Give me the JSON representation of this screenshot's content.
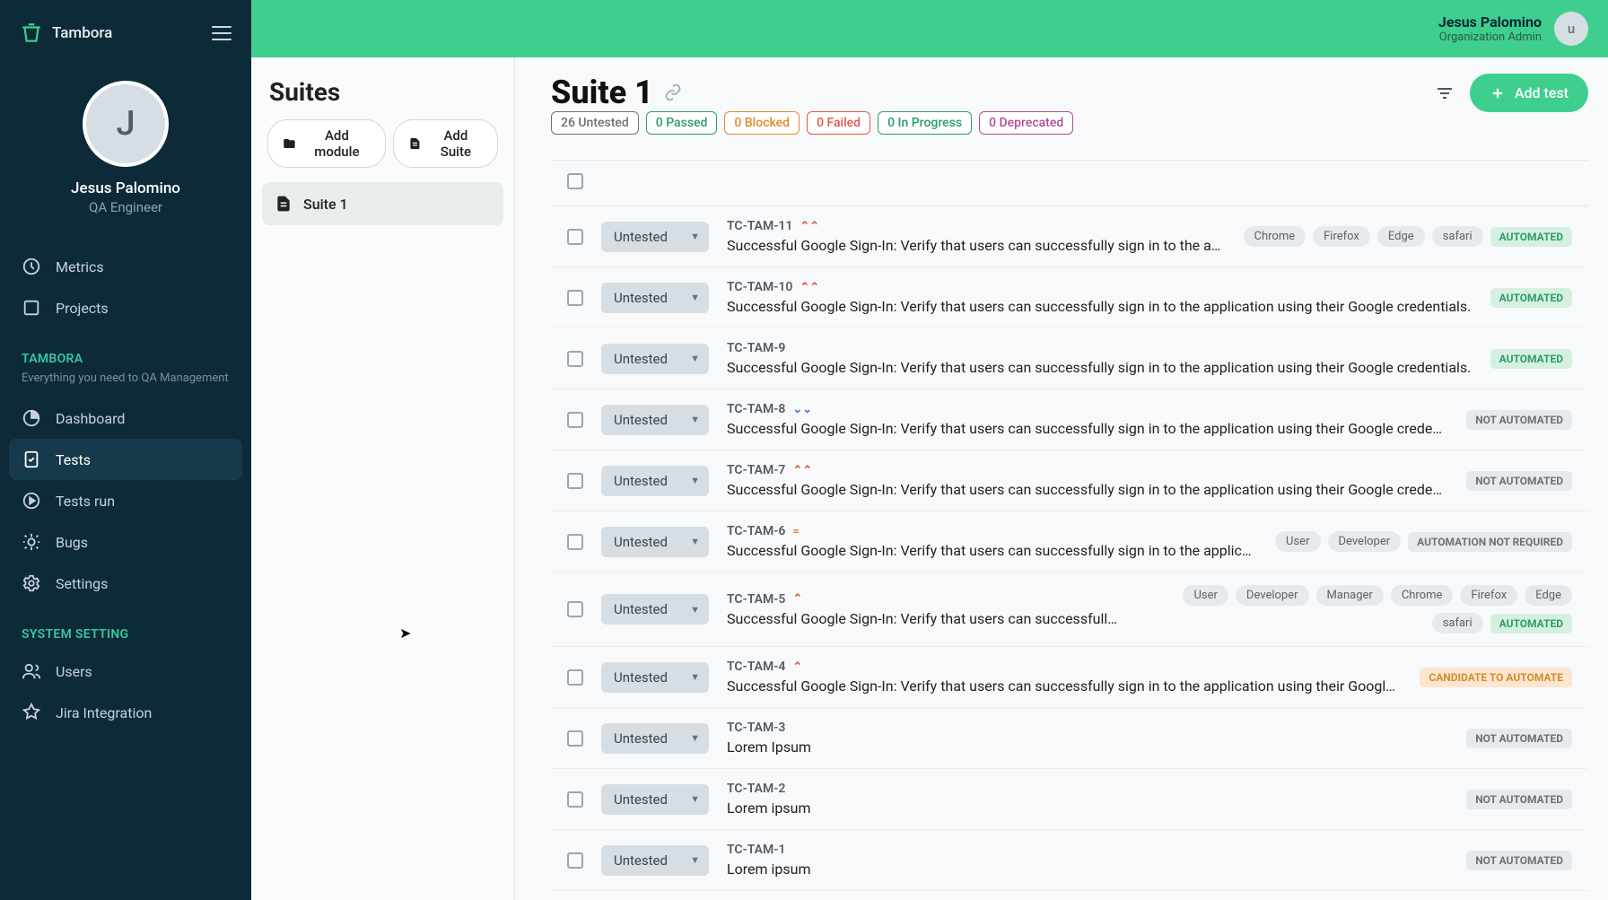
{
  "brand": {
    "name": "Tambora"
  },
  "profile": {
    "initial": "J",
    "name": "Jesus Palomino",
    "role": "QA Engineer"
  },
  "topbar": {
    "name": "Jesus Palomino",
    "role": "Organization Admin",
    "avatar_initial": "u"
  },
  "nav_top": [
    {
      "label": "Metrics"
    },
    {
      "label": "Projects"
    }
  ],
  "section1": {
    "title": "TAMBORA",
    "desc": "Everything you need to QA Management"
  },
  "nav_main": [
    {
      "label": "Dashboard"
    },
    {
      "label": "Tests"
    },
    {
      "label": "Tests run"
    },
    {
      "label": "Bugs"
    },
    {
      "label": "Settings"
    }
  ],
  "section2": {
    "title": "SYSTEM SETTING"
  },
  "nav_sys": [
    {
      "label": "Users"
    },
    {
      "label": "Jira Integration"
    }
  ],
  "suites": {
    "title": "Suites",
    "add_module": "Add module",
    "add_suite": "Add Suite",
    "items": [
      {
        "label": "Suite 1"
      }
    ]
  },
  "detail": {
    "title": "Suite 1",
    "add_test": "Add test"
  },
  "status_chips": [
    {
      "label": "26 Untested",
      "color": "#6a7278"
    },
    {
      "label": "0 Passed",
      "color": "#2d9c6a"
    },
    {
      "label": "0 Blocked",
      "color": "#e08a2a"
    },
    {
      "label": "0 Failed",
      "color": "#e0574b"
    },
    {
      "label": "0 In Progress",
      "color": "#2d9c6a"
    },
    {
      "label": "0 Deprecated",
      "color": "#b04b9c"
    }
  ],
  "status_default": "Untested",
  "tests": [
    {
      "id": "TC-TAM-11",
      "pri": "highest",
      "title": "Successful Google Sign-In: Verify that users can successfully sign in to the application using thei...",
      "badge": "AUTOMATED",
      "btype": "auto",
      "tags": [
        "Chrome",
        "Firefox",
        "Edge",
        "safari"
      ]
    },
    {
      "id": "TC-TAM-10",
      "pri": "highest",
      "title": "Successful Google Sign-In: Verify that users can successfully sign in to the application using their Google credentials.",
      "badge": "AUTOMATED",
      "btype": "auto",
      "tags": []
    },
    {
      "id": "TC-TAM-9",
      "pri": "",
      "title": "Successful Google Sign-In: Verify that users can successfully sign in to the application using their Google credentials.",
      "badge": "AUTOMATED",
      "btype": "auto",
      "tags": []
    },
    {
      "id": "TC-TAM-8",
      "pri": "lowest",
      "title": "Successful Google Sign-In: Verify that users can successfully sign in to the application using their Google credentials.",
      "badge": "NOT AUTOMATED",
      "btype": "noauto",
      "tags": []
    },
    {
      "id": "TC-TAM-7",
      "pri": "highest",
      "title": "Successful Google Sign-In: Verify that users can successfully sign in to the application using their Google credentials.",
      "badge": "NOT AUTOMATED",
      "btype": "noauto",
      "tags": []
    },
    {
      "id": "TC-TAM-6",
      "pri": "medium",
      "title": "Successful Google Sign-In: Verify that users can successfully sign in to the application using their Google cre...",
      "badge": "AUTOMATION NOT REQUIRED",
      "btype": "noreq",
      "tags": [
        "User",
        "Developer"
      ]
    },
    {
      "id": "TC-TAM-5",
      "pri": "high",
      "title": "Successful Google Sign-In: Verify that users can successfully sig...",
      "badge": "AUTOMATED",
      "btype": "auto",
      "tags": [
        "User",
        "Developer",
        "Manager",
        "Chrome",
        "Firefox",
        "Edge",
        "safari"
      ]
    },
    {
      "id": "TC-TAM-4",
      "pri": "high",
      "title": "Successful Google Sign-In: Verify that users can successfully sign in to the application using their Google crede...",
      "badge": "CANDIDATE TO AUTOMATE",
      "btype": "cand",
      "tags": []
    },
    {
      "id": "TC-TAM-3",
      "pri": "",
      "title": "Lorem Ipsum",
      "badge": "NOT AUTOMATED",
      "btype": "noauto",
      "tags": []
    },
    {
      "id": "TC-TAM-2",
      "pri": "",
      "title": "Lorem ipsum",
      "badge": "NOT AUTOMATED",
      "btype": "noauto",
      "tags": []
    },
    {
      "id": "TC-TAM-1",
      "pri": "",
      "title": "Lorem ipsum",
      "badge": "NOT AUTOMATED",
      "btype": "noauto",
      "tags": []
    }
  ]
}
